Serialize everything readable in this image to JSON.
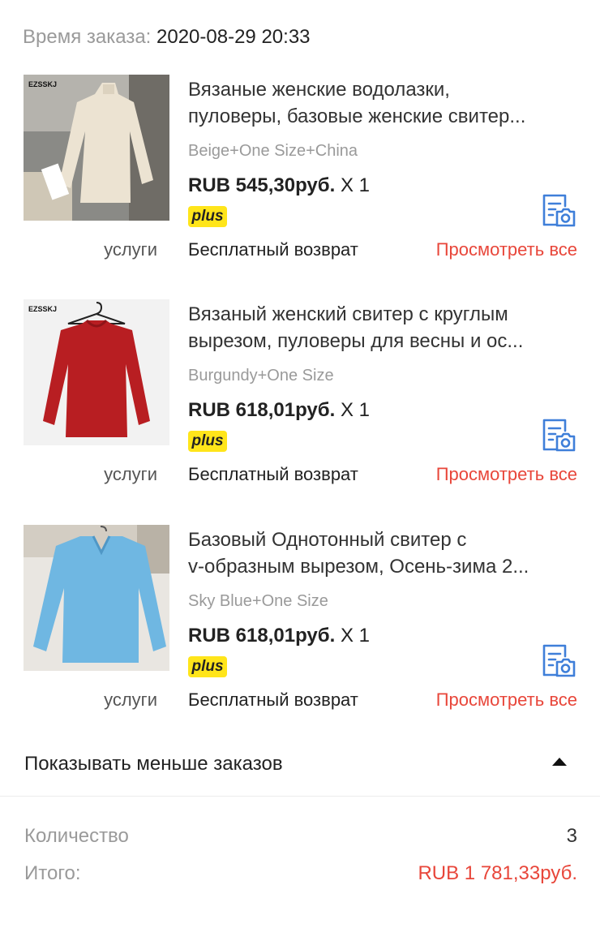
{
  "order": {
    "time_label": "Время заказа:",
    "time_value": "2020-08-29 20:33"
  },
  "products": [
    {
      "image_brand": "EZSSKJ",
      "title_line1": "Вязаные женские водолазки,",
      "title_line2": "пуловеры, базовые женские свитер...",
      "variant": "Beige+One Size+China",
      "price": "RUB 545,30руб.",
      "quantity": "X 1",
      "badge": "plus",
      "services_label": "услуги",
      "services_value": "Бесплатный возврат",
      "view_all": "Просмотреть все",
      "sweater_color": "#ece3d2",
      "icon": "document-camera-icon"
    },
    {
      "image_brand": "EZSSKJ",
      "title_line1": "Вязаный женский свитер с круглым",
      "title_line2": "вырезом, пуловеры для весны и ос...",
      "variant": "Burgundy+One Size",
      "price": "RUB 618,01руб.",
      "quantity": "X 1",
      "badge": "plus",
      "services_label": "услуги",
      "services_value": "Бесплатный возврат",
      "view_all": "Просмотреть все",
      "sweater_color": "#b81e22",
      "icon": "document-camera-icon"
    },
    {
      "title_line1": "Базовый Однотонный свитер с",
      "title_line2": "v-образным вырезом, Осень-зима 2...",
      "variant": "Sky Blue+One Size",
      "price": "RUB 618,01руб.",
      "quantity": "X 1",
      "badge": "plus",
      "services_label": "услуги",
      "services_value": "Бесплатный возврат",
      "view_all": "Просмотреть все",
      "sweater_color": "#6fb7e2",
      "icon": "document-camera-icon"
    }
  ],
  "toggle": {
    "label": "Показывать меньше заказов",
    "icon": "caret-up-icon"
  },
  "summary": {
    "quantity_label": "Количество",
    "quantity_value": "3",
    "total_label": "Итого:",
    "total_value": "RUB 1 781,33руб."
  },
  "colors": {
    "accent_red": "#e8463a",
    "badge_yellow": "#ffe51a",
    "icon_blue": "#3f7fd9",
    "muted_gray": "#9a9a9a"
  }
}
